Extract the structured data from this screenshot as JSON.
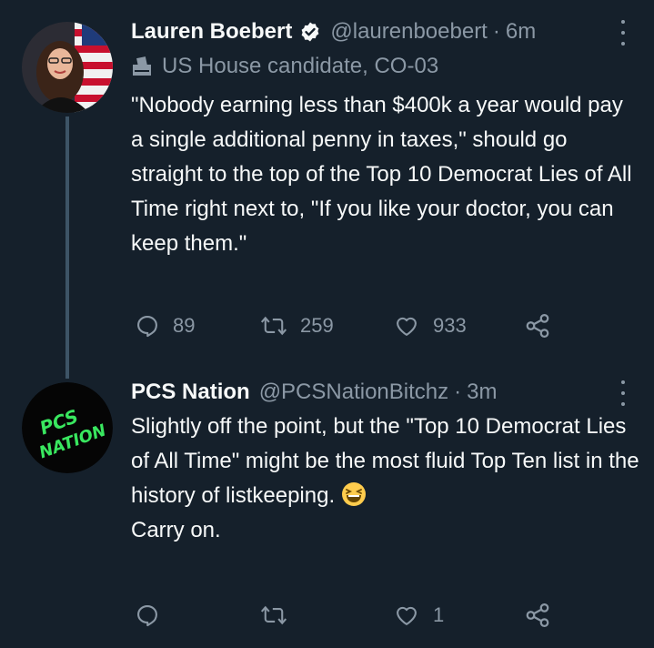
{
  "tweet1": {
    "name": "Lauren Boebert",
    "handle": "@laurenboebert",
    "separator": "·",
    "time": "6m",
    "label": "US House candidate, CO-03",
    "text": "\"Nobody earning less than $400k a year would pay a single additional penny in taxes,\" should go straight to the top of the Top 10 Democrat Lies of All Time right next to, \"If you like your doctor, you can keep them.\"",
    "replies": "89",
    "retweets": "259",
    "likes": "933"
  },
  "tweet2": {
    "name": "PCS Nation",
    "handle": "@PCSNationBitchz",
    "separator": "·",
    "time": "3m",
    "avatar_text_line1": "PCS",
    "avatar_text_line2": "NATION",
    "text_part1": "Slightly off the point, but the \"Top 10 Democrat Lies of All Time\" might be the most fluid Top Ten list in the history of listkeeping.",
    "text_part2": "Carry on.",
    "likes": "1"
  },
  "colors": {
    "background": "#15202b",
    "text": "#f7f9f9",
    "muted": "#8b98a5",
    "thread_line": "#3d5466",
    "avatar_green": "#39e75f"
  },
  "icons": [
    "verified-badge-icon",
    "ballot-box-icon",
    "reply-icon",
    "retweet-icon",
    "like-icon",
    "share-icon",
    "more-icon",
    "laughing-emoji-icon"
  ]
}
